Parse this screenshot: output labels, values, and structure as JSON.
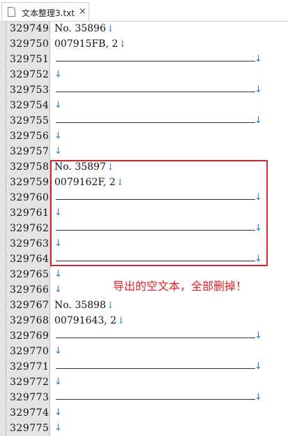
{
  "tab": {
    "title": "文本整理3.txt",
    "close": "×"
  },
  "annotation": "导出的空文本，全部删掉！",
  "lines": [
    {
      "n": "329749",
      "t": "No. 35896"
    },
    {
      "n": "329750",
      "t": "007915FB, 2"
    },
    {
      "n": "329751",
      "t": "------------------"
    },
    {
      "n": "329752",
      "t": ""
    },
    {
      "n": "329753",
      "t": "------------------"
    },
    {
      "n": "329754",
      "t": ""
    },
    {
      "n": "329755",
      "t": "------------------"
    },
    {
      "n": "329756",
      "t": ""
    },
    {
      "n": "329757",
      "t": ""
    },
    {
      "n": "329758",
      "t": "No. 35897"
    },
    {
      "n": "329759",
      "t": "0079162F, 2"
    },
    {
      "n": "329760",
      "t": "------------------"
    },
    {
      "n": "329761",
      "t": ""
    },
    {
      "n": "329762",
      "t": "------------------"
    },
    {
      "n": "329763",
      "t": ""
    },
    {
      "n": "329764",
      "t": "------------------"
    },
    {
      "n": "329765",
      "t": ""
    },
    {
      "n": "329766",
      "t": ""
    },
    {
      "n": "329767",
      "t": "No. 35898"
    },
    {
      "n": "329768",
      "t": "00791643, 2"
    },
    {
      "n": "329769",
      "t": "------------------"
    },
    {
      "n": "329770",
      "t": ""
    },
    {
      "n": "329771",
      "t": "------------------"
    },
    {
      "n": "329772",
      "t": ""
    },
    {
      "n": "329773",
      "t": "------------------"
    },
    {
      "n": "329774",
      "t": ""
    },
    {
      "n": "329775",
      "t": ""
    }
  ]
}
